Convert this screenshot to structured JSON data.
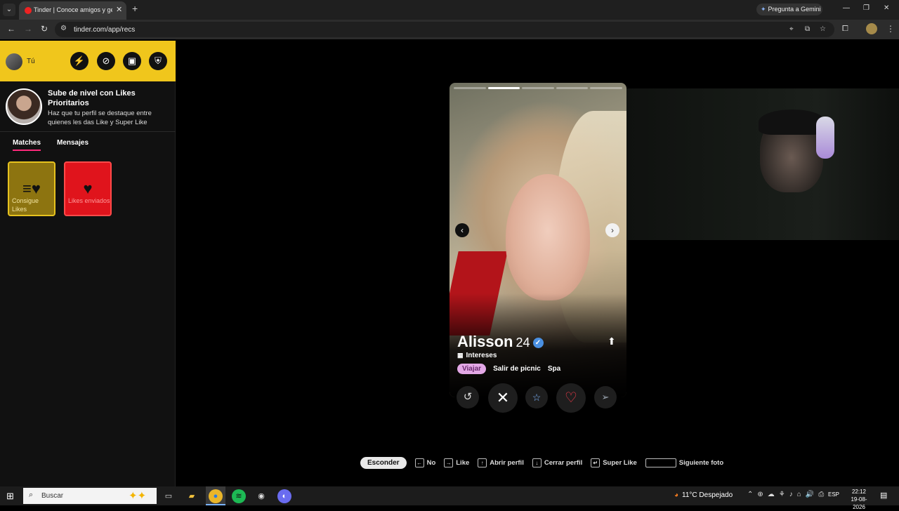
{
  "browser": {
    "tab_title": "Tinder | Conoce amigos y gente",
    "gemini_label": "Pregunta a Gemini",
    "url": "tinder.com/app/recs"
  },
  "sidebar": {
    "user_name": "Tú",
    "promo": {
      "title": "Sube de nivel con Likes Prioritarios",
      "subtitle": "Haz que tu perfil se destaque entre quienes les das Like y Super Like"
    },
    "tabs": [
      "Matches",
      "Mensajes"
    ],
    "tiles": [
      {
        "label": "Consigue Likes",
        "icon": "likes-stack-icon"
      },
      {
        "label": "Likes enviados",
        "icon": "heart-icon"
      }
    ]
  },
  "card": {
    "name": "Alisson",
    "age": "24",
    "photo_count": 5,
    "current_photo": 2,
    "interests_label": "Intereses",
    "interests": [
      "Viajar",
      "Salir de picnic",
      "Spa"
    ]
  },
  "shortcuts": {
    "hide": "Esconder",
    "items": [
      {
        "key": "←",
        "label": "No"
      },
      {
        "key": "→",
        "label": "Like"
      },
      {
        "key": "↑",
        "label": "Abrir perfil"
      },
      {
        "key": "↓",
        "label": "Cerrar perfil"
      },
      {
        "key": "↵",
        "label": "Super Like"
      },
      {
        "key": "",
        "label": "Siguiente foto"
      }
    ]
  },
  "taskbar": {
    "search_placeholder": "Buscar",
    "weather": "11°C  Despejado",
    "lang": "ESP",
    "time": "22:12",
    "date": "19-08-2026"
  },
  "colors": {
    "tinder_yellow": "#f0c61c",
    "like_red": "#ff3d4d",
    "chip_pink": "#e3a8e6",
    "verified_blue": "#4a90e2"
  }
}
